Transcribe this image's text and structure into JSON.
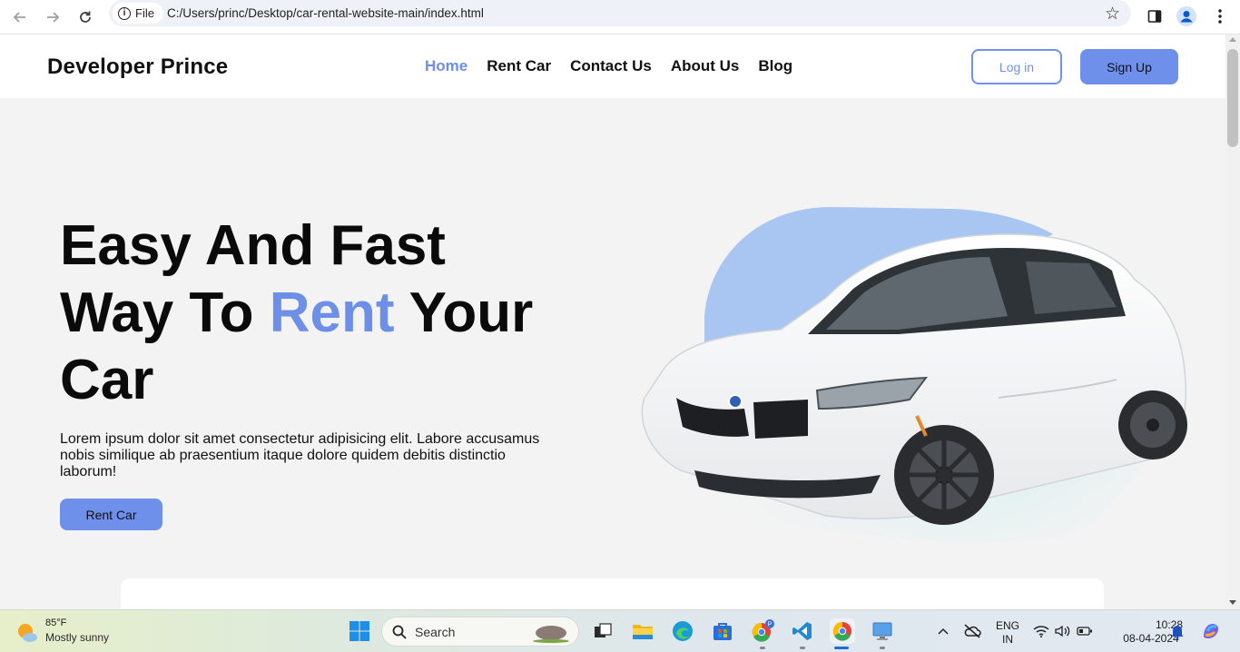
{
  "browser": {
    "site_chip_label": "File",
    "url": "C:/Users/princ/Desktop/car-rental-website-main/index.html"
  },
  "header": {
    "logo": "Developer Prince",
    "nav": [
      {
        "label": "Home",
        "active": true
      },
      {
        "label": "Rent Car",
        "active": false
      },
      {
        "label": "Contact Us",
        "active": false
      },
      {
        "label": "About Us",
        "active": false
      },
      {
        "label": "Blog",
        "active": false
      }
    ],
    "login_label": "Log in",
    "signup_label": "Sign Up"
  },
  "hero": {
    "title_line1": "Easy And Fast",
    "title_line2_start": "Way To ",
    "title_accent": "Rent",
    "title_line2_end": " Your",
    "title_line3": "Car",
    "description": "Lorem ipsum dolor sit amet consectetur adipisicing elit. Labore accusamus nobis similique ab praesentium itaque dolore quidem debitis distinctio laborum!",
    "cta_label": "Rent Car"
  },
  "colors": {
    "accent": "#6d8fe8",
    "button": "#6f90ea",
    "page_bg": "#f3f3f3"
  },
  "taskbar": {
    "weather_temp": "85°F",
    "weather_condition": "Mostly sunny",
    "search_label": "Search",
    "language_line1": "ENG",
    "language_line2": "IN",
    "time": "10:28",
    "date": "08-04-2024",
    "icons": [
      "start-icon",
      "search-icon",
      "task-view-icon",
      "file-explorer-icon",
      "edge-icon",
      "store-icon",
      "chrome-profile-icon",
      "vscode-icon",
      "chrome-icon",
      "remote-desktop-icon"
    ]
  }
}
